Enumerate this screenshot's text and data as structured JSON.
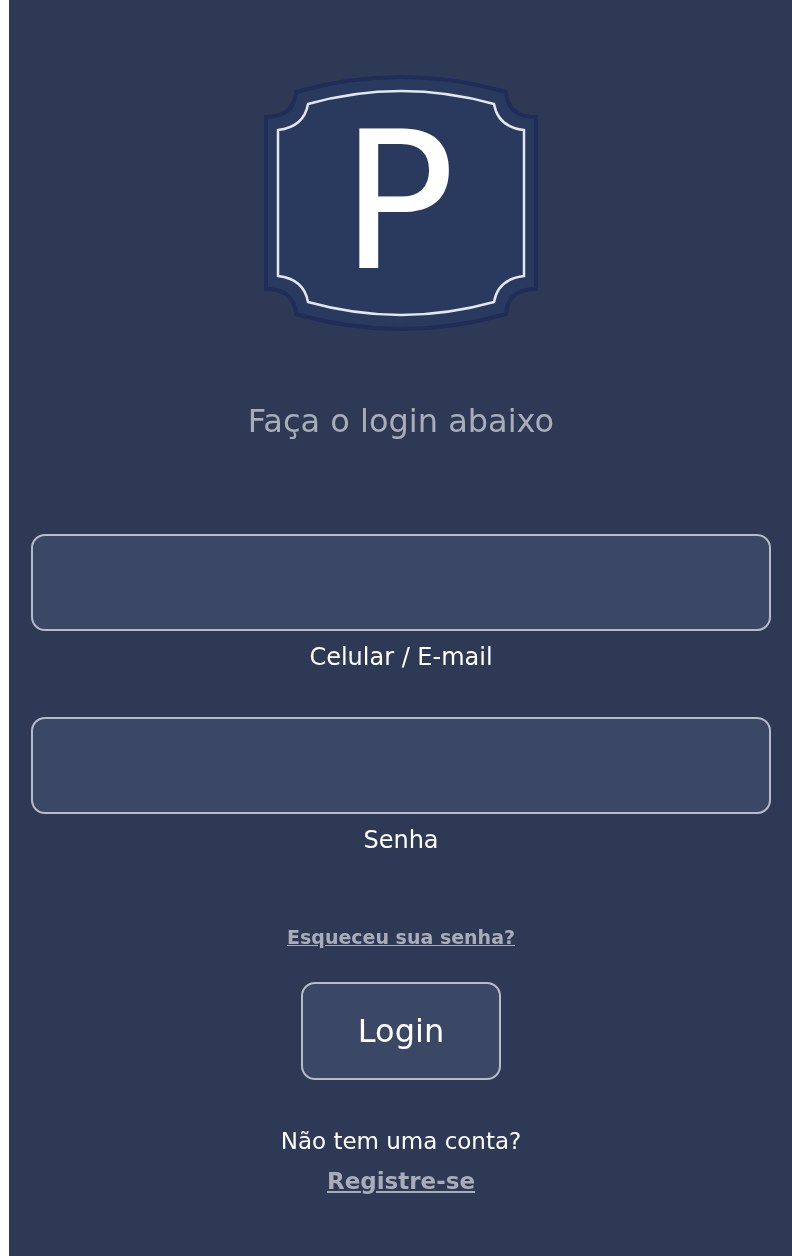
{
  "logo": {
    "letter": "P"
  },
  "heading": "Faça o login abaixo",
  "fields": [
    {
      "label": "Celular / E-mail"
    },
    {
      "label": "Senha"
    }
  ],
  "forgot_link": "Esqueceu sua senha?",
  "login_button": "Login",
  "signup_prompt": "Não tem uma conta?",
  "signup_link": "Registre-se"
}
